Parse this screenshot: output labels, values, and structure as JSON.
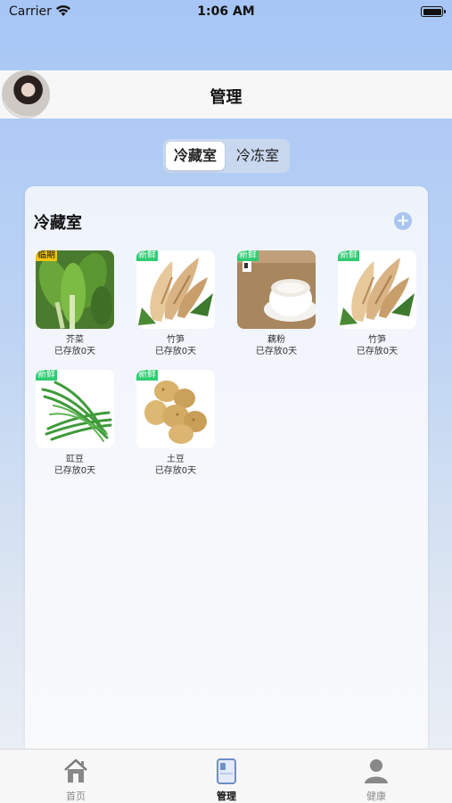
{
  "status": {
    "carrier": "Carrier",
    "time": "1:06 AM"
  },
  "nav": {
    "title": "管理"
  },
  "segment": {
    "tabs": [
      {
        "label": "冷藏室",
        "active": true
      },
      {
        "label": "冷冻室",
        "active": false
      }
    ]
  },
  "card": {
    "title": "冷藏室",
    "add_label": "+"
  },
  "items": [
    {
      "name": "芥菜",
      "days": "已存放0天",
      "tag": "临期",
      "tag_type": "near",
      "image": "leafy-greens"
    },
    {
      "name": "竹笋",
      "days": "已存放0天",
      "tag": "新鲜",
      "tag_type": "fresh",
      "image": "bamboo-shoots"
    },
    {
      "name": "藕粉",
      "days": "已存放0天",
      "tag": "新鲜",
      "tag_type": "fresh",
      "image": "lotus-root-powder"
    },
    {
      "name": "竹笋",
      "days": "已存放0天",
      "tag": "新鲜",
      "tag_type": "fresh",
      "image": "bamboo-shoots"
    },
    {
      "name": "豇豆",
      "days": "已存放0天",
      "tag": "新鲜",
      "tag_type": "fresh",
      "image": "long-beans"
    },
    {
      "name": "土豆",
      "days": "已存放0天",
      "tag": "新鲜",
      "tag_type": "fresh",
      "image": "potatoes"
    }
  ],
  "tabbar": {
    "tabs": [
      {
        "label": "首页",
        "icon": "home-icon"
      },
      {
        "label": "管理",
        "icon": "manage-icon",
        "active": true
      },
      {
        "label": "健康",
        "icon": "person-icon"
      }
    ]
  },
  "colors": {
    "accent": "#a9c4ef",
    "fresh_tag": "#2ecc71",
    "near_tag": "#f1c40f"
  }
}
